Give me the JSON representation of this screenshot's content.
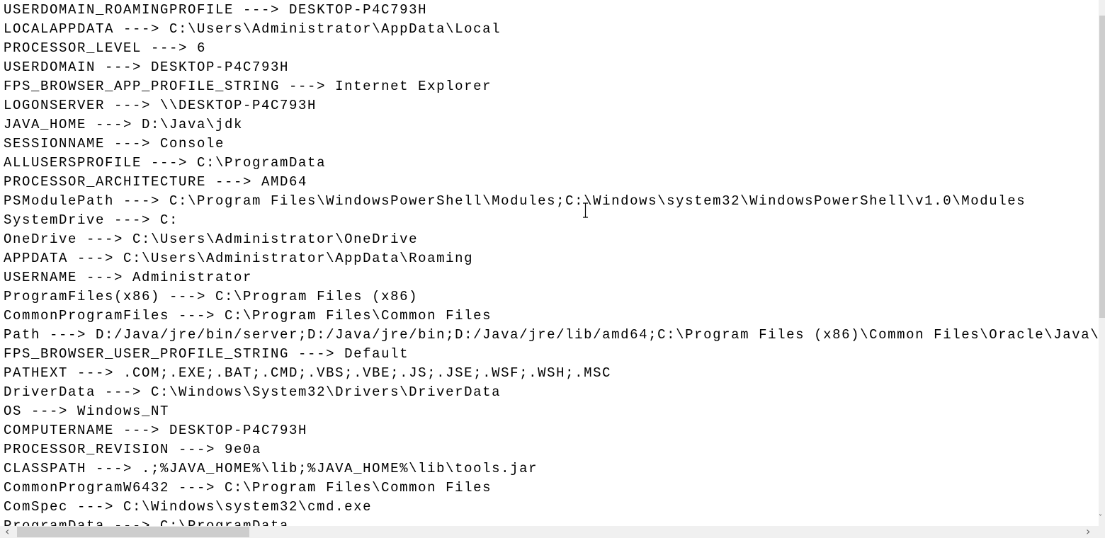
{
  "lines": [
    "USERDOMAIN_ROAMINGPROFILE ---> DESKTOP-P4C793H",
    "LOCALAPPDATA ---> C:\\Users\\Administrator\\AppData\\Local",
    "PROCESSOR_LEVEL ---> 6",
    "USERDOMAIN ---> DESKTOP-P4C793H",
    "FPS_BROWSER_APP_PROFILE_STRING ---> Internet Explorer",
    "LOGONSERVER ---> \\\\DESKTOP-P4C793H",
    "JAVA_HOME ---> D:\\Java\\jdk",
    "SESSIONNAME ---> Console",
    "ALLUSERSPROFILE ---> C:\\ProgramData",
    "PROCESSOR_ARCHITECTURE ---> AMD64",
    "PSModulePath ---> C:\\Program Files\\WindowsPowerShell\\Modules;C:\\Windows\\system32\\WindowsPowerShell\\v1.0\\Modules",
    "SystemDrive ---> C:",
    "OneDrive ---> C:\\Users\\Administrator\\OneDrive",
    "APPDATA ---> C:\\Users\\Administrator\\AppData\\Roaming",
    "USERNAME ---> Administrator",
    "ProgramFiles(x86) ---> C:\\Program Files (x86)",
    "CommonProgramFiles ---> C:\\Program Files\\Common Files",
    "Path ---> D:/Java/jre/bin/server;D:/Java/jre/bin;D:/Java/jre/lib/amd64;C:\\Program Files (x86)\\Common Files\\Oracle\\Java\\",
    "FPS_BROWSER_USER_PROFILE_STRING ---> Default",
    "PATHEXT ---> .COM;.EXE;.BAT;.CMD;.VBS;.VBE;.JS;.JSE;.WSF;.WSH;.MSC",
    "DriverData ---> C:\\Windows\\System32\\Drivers\\DriverData",
    "OS ---> Windows_NT",
    "COMPUTERNAME ---> DESKTOP-P4C793H",
    "PROCESSOR_REVISION ---> 9e0a",
    "CLASSPATH ---> .;%JAVA_HOME%\\lib;%JAVA_HOME%\\lib\\tools.jar",
    "CommonProgramW6432 ---> C:\\Program Files\\Common Files",
    "ComSpec ---> C:\\Windows\\system32\\cmd.exe",
    "ProgramData ---> C:\\ProgramData"
  ],
  "scroll": {
    "vertical_position_fraction": 0.03,
    "horizontal_position_fraction": 0.02
  },
  "icons": {
    "scroll_left": "‹",
    "scroll_right": "›",
    "scroll_up": "˄",
    "scroll_down": "˅"
  }
}
